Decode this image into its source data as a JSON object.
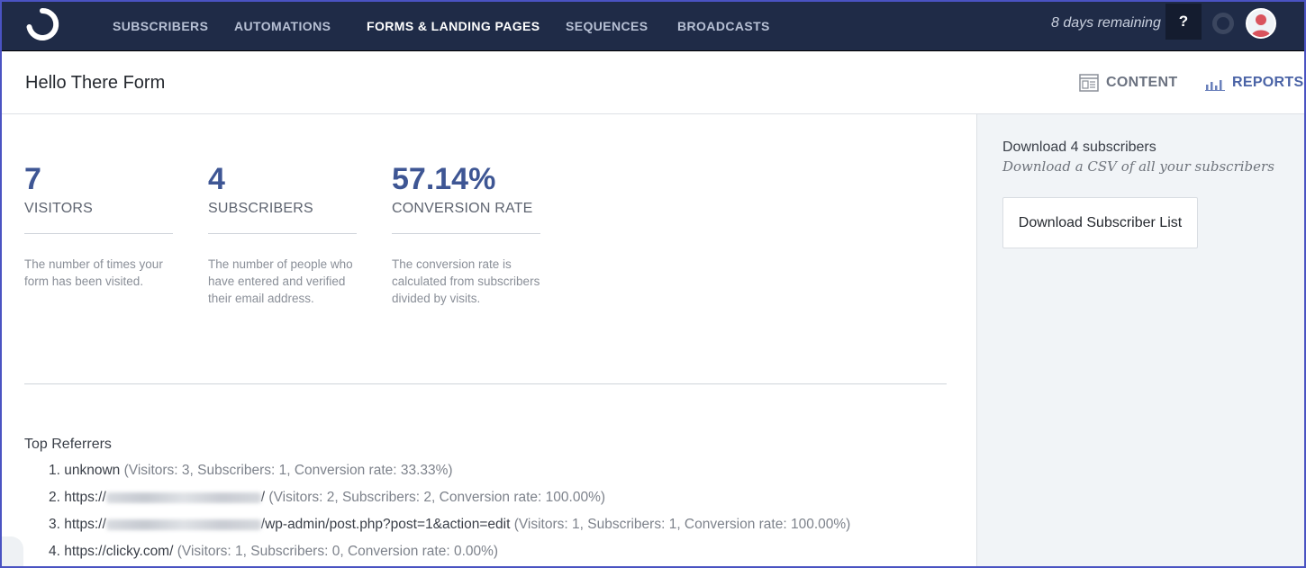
{
  "nav": {
    "items": [
      {
        "label": "SUBSCRIBERS",
        "active": false
      },
      {
        "label": "AUTOMATIONS",
        "active": false
      },
      {
        "label": "FORMS & LANDING PAGES",
        "active": true
      },
      {
        "label": "SEQUENCES",
        "active": false
      },
      {
        "label": "BROADCASTS",
        "active": false
      }
    ],
    "trial_text": "8 days remaining",
    "help_label": "?"
  },
  "header": {
    "title": "Hello There Form",
    "tabs": [
      {
        "label": "CONTENT",
        "icon": "content-icon",
        "active": false
      },
      {
        "label": "REPORTS",
        "icon": "bar-chart-icon",
        "active": true
      }
    ]
  },
  "stats": [
    {
      "value": "7",
      "label": "VISITORS",
      "description": "The number of times your form has been visited."
    },
    {
      "value": "4",
      "label": "SUBSCRIBERS",
      "description": "The number of people who have entered and verified their email address."
    },
    {
      "value": "57.14%",
      "label": "CONVERSION RATE",
      "description": "The conversion rate is calculated from subscribers divided by visits."
    }
  ],
  "referrers": {
    "heading": "Top Referrers",
    "items": [
      {
        "number": "1.",
        "prefix": "unknown",
        "redacted": false,
        "suffix": "",
        "stats": "(Visitors: 3, Subscribers: 1, Conversion rate: 33.33%)"
      },
      {
        "number": "2.",
        "prefix": "https://",
        "redacted": true,
        "suffix": "/",
        "stats": "(Visitors: 2, Subscribers: 2, Conversion rate: 100.00%)"
      },
      {
        "number": "3.",
        "prefix": "https://",
        "redacted": true,
        "suffix": "/wp-admin/post.php?post=1&action=edit",
        "stats": "(Visitors: 1, Subscribers: 1, Conversion rate: 100.00%)"
      },
      {
        "number": "4.",
        "prefix": "https://clicky.com/",
        "redacted": false,
        "suffix": "",
        "stats": "(Visitors: 1, Subscribers: 0, Conversion rate: 0.00%)"
      }
    ]
  },
  "sidebar": {
    "download_title": "Download 4 subscribers",
    "download_subtitle": "Download a CSV of all your subscribers",
    "download_button": "Download Subscriber List"
  },
  "colors": {
    "nav_bg": "#1f2b47",
    "accent": "#3e5694",
    "tab_active": "#4a63a6",
    "sidebar_bg": "#f1f4f7",
    "frame": "#4a53c2"
  }
}
